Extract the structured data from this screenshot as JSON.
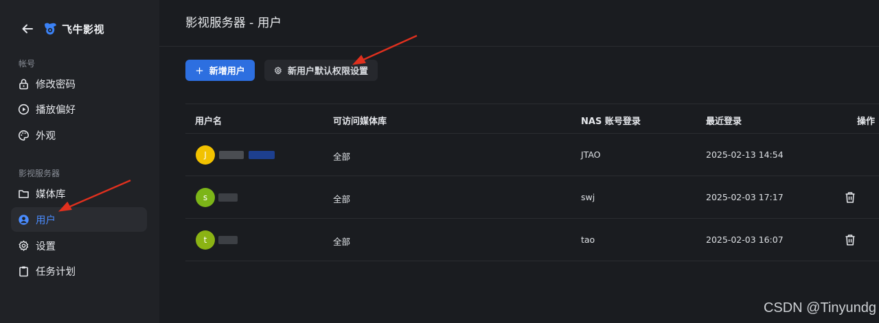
{
  "sidebar": {
    "brand": "飞牛影视",
    "sections": {
      "account": "帐号",
      "server": "影视服务器"
    },
    "items": [
      {
        "label": "修改密码",
        "icon": "lock-icon"
      },
      {
        "label": "播放偏好",
        "icon": "play-circle-icon"
      },
      {
        "label": "外观",
        "icon": "palette-icon"
      },
      {
        "label": "媒体库",
        "icon": "folder-icon"
      },
      {
        "label": "用户",
        "icon": "user-circle-icon",
        "active": true
      },
      {
        "label": "设置",
        "icon": "gear-icon"
      },
      {
        "label": "任务计划",
        "icon": "clipboard-icon"
      }
    ]
  },
  "main": {
    "title": "影视服务器 - 用户",
    "add_user_label": "新增用户",
    "default_perm_label": "新用户默认权限设置"
  },
  "table": {
    "headers": [
      "用户名",
      "可访问媒体库",
      "NAS 账号登录",
      "最近登录",
      "操作"
    ],
    "rows": [
      {
        "initial": "J",
        "avatar_color": "#f2c200",
        "library": "全部",
        "nas_account": "JTAO",
        "last_login": "2025-02-13 14:54",
        "deletable": false
      },
      {
        "initial": "s",
        "avatar_color": "#7cb518",
        "library": "全部",
        "nas_account": "swj",
        "last_login": "2025-02-03 17:17",
        "deletable": true
      },
      {
        "initial": "t",
        "avatar_color": "#8bb314",
        "library": "全部",
        "nas_account": "tao",
        "last_login": "2025-02-03 16:07",
        "deletable": true
      }
    ]
  },
  "colors": {
    "accent": "#2d6fe0",
    "active_text": "#4a8cff",
    "annotation_arrow": "#e0301e"
  },
  "watermark": "CSDN @Tinyundg"
}
